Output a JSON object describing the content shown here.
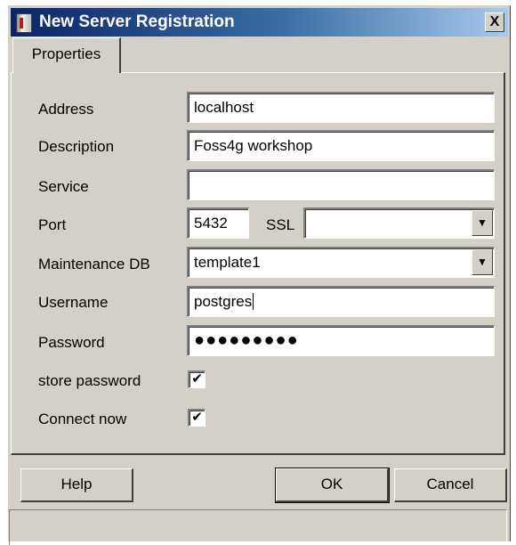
{
  "window": {
    "title": "New Server Registration",
    "close_label": "X",
    "app_icon": "server-icon"
  },
  "tabs": [
    {
      "label": "Properties"
    }
  ],
  "form": {
    "address": {
      "label": "Address",
      "value": "localhost"
    },
    "description": {
      "label": "Description",
      "value": "Foss4g workshop"
    },
    "service": {
      "label": "Service",
      "value": ""
    },
    "port": {
      "label": "Port",
      "value": "5432"
    },
    "ssl": {
      "label": "SSL",
      "value": ""
    },
    "maintenance_db": {
      "label": "Maintenance DB",
      "value": "template1"
    },
    "username": {
      "label": "Username",
      "value": "postgres"
    },
    "password": {
      "label": "Password",
      "value": "●●●●●●●●●"
    },
    "store_password": {
      "label": "store password",
      "checked": true,
      "mark": "✔"
    },
    "connect_now": {
      "label": "Connect now",
      "checked": true,
      "mark": "✔"
    }
  },
  "buttons": {
    "help": "Help",
    "ok": "OK",
    "cancel": "Cancel"
  },
  "icons": {
    "dropdown": "▼"
  }
}
